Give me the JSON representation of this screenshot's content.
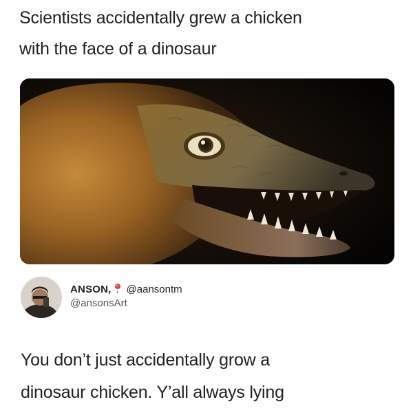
{
  "post": {
    "headline_line1": "Scientists accidentally grew a chicken",
    "headline_line2": "with the face of a dinosaur"
  },
  "image": {
    "subject": "dinosaur-chicken-photo"
  },
  "tweet": {
    "display_name": "ANSON,",
    "name_handle": "@aansontm",
    "handle": "@ansonsArt",
    "body_line1": "You don’t just accidentally grow a",
    "body_line2": "dinosaur chicken. Y’all always lying"
  },
  "colors": {
    "text": "#222222",
    "handle": "#555555",
    "background": "#ffffff",
    "photo_background": "#0b0907"
  }
}
